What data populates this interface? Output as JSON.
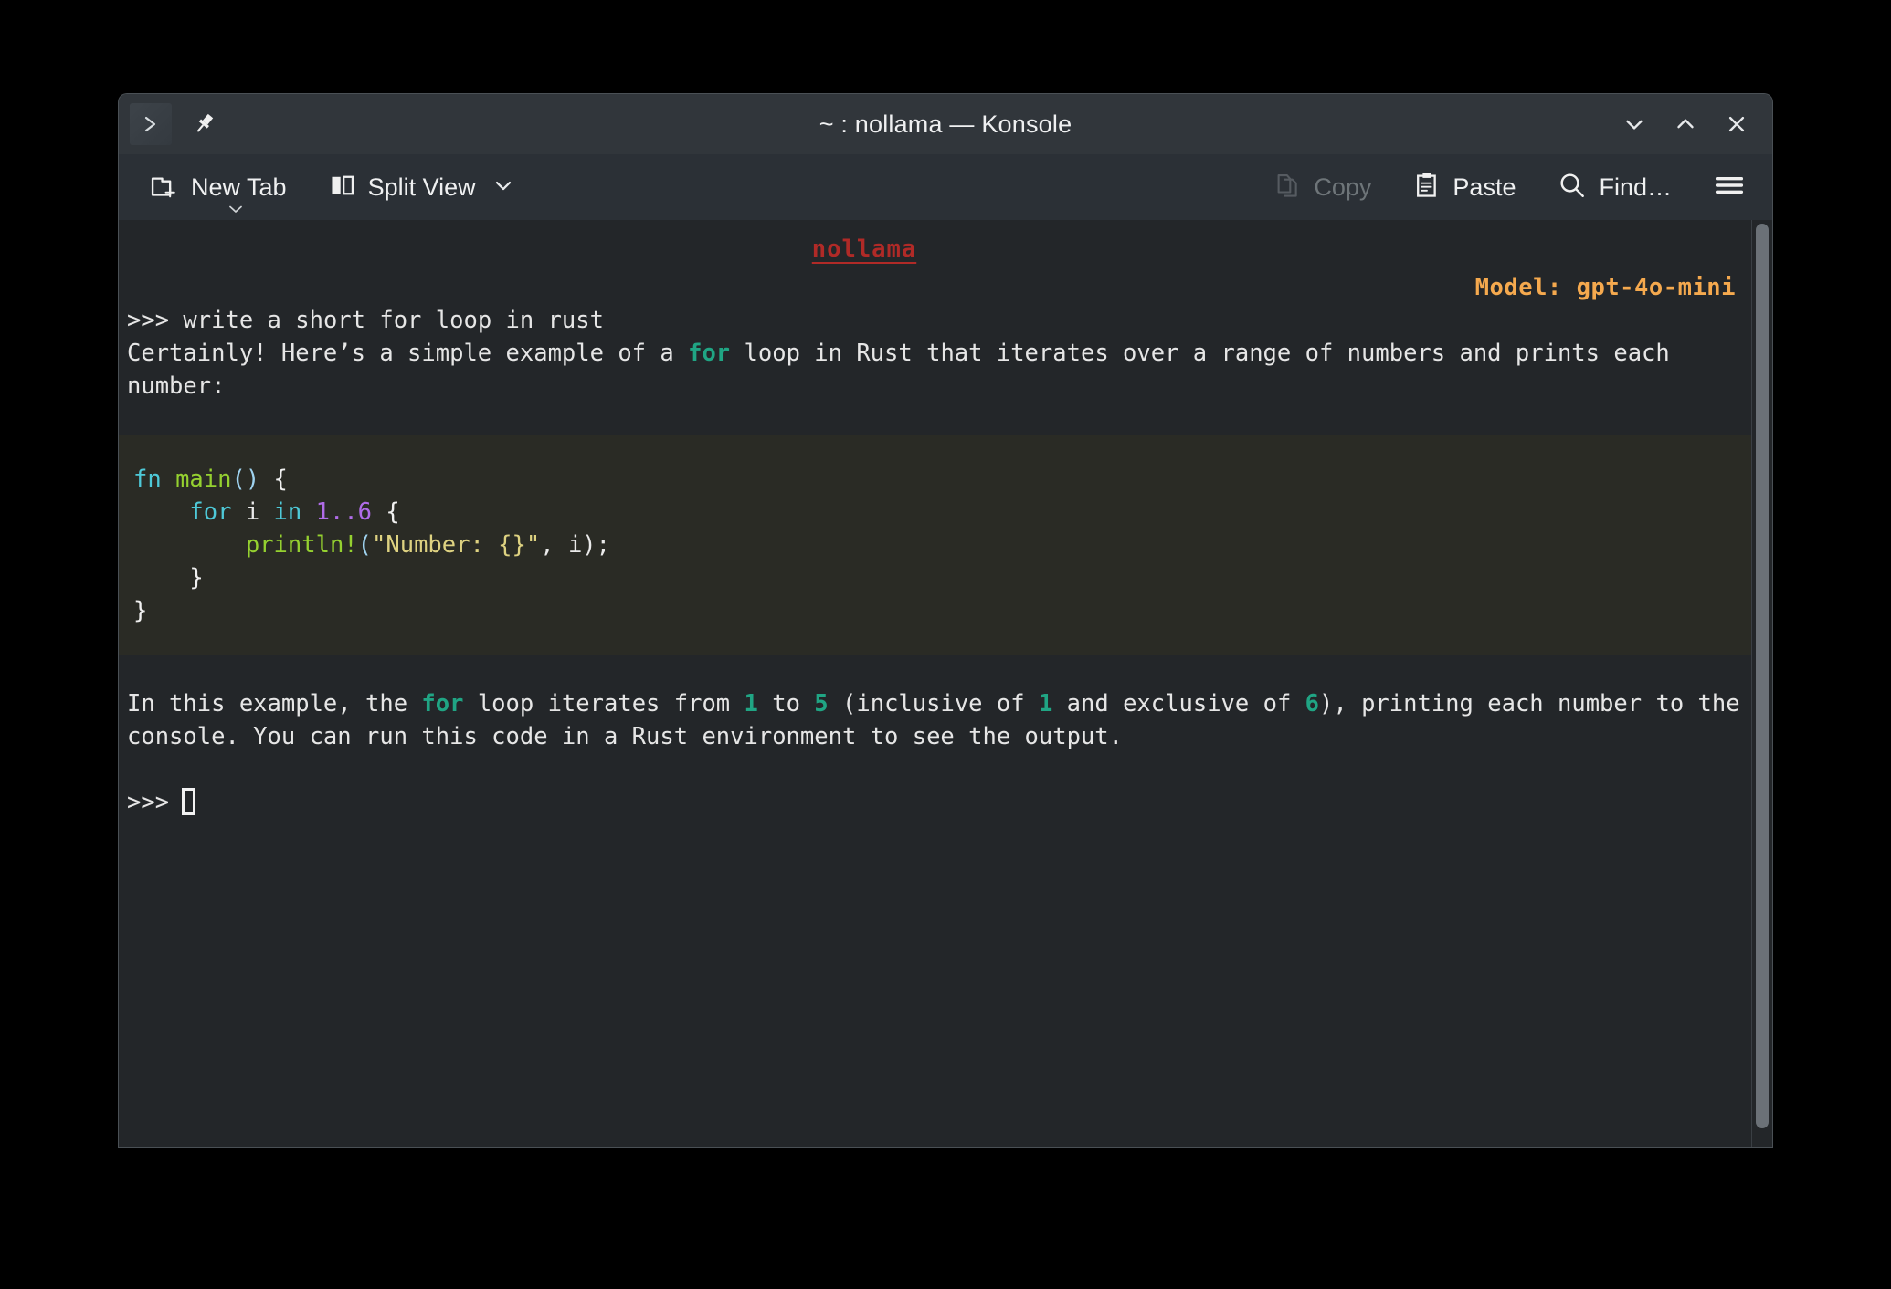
{
  "window": {
    "title": "~ : nollama — Konsole",
    "app_icon": "terminal-prompt-icon",
    "pin_icon": "pin-icon",
    "minimize_icon": "chevron-down-icon",
    "maximize_icon": "chevron-up-icon",
    "close_icon": "close-icon"
  },
  "toolbar": {
    "new_tab_label": "New Tab",
    "new_tab_icon": "new-tab-icon",
    "new_tab_more_icon": "chevron-down-small-icon",
    "split_view_label": "Split View",
    "split_view_icon": "split-view-icon",
    "split_view_chevron_icon": "chevron-down-icon",
    "copy_label": "Copy",
    "copy_icon": "copy-icon",
    "copy_disabled": true,
    "paste_label": "Paste",
    "paste_icon": "clipboard-paste-icon",
    "find_label": "Find…",
    "find_icon": "search-icon",
    "menu_icon": "hamburger-menu-icon"
  },
  "terminal": {
    "banner": "nollama",
    "model_line": "Model: gpt-4o-mini",
    "prompt_symbol": ">>>",
    "user_command": "write a short for loop in rust",
    "intro": {
      "part1": "Certainly! Here’s a simple example of a ",
      "code1": "for",
      "part2": " loop in Rust that iterates over a range of numbers and prints each number:"
    },
    "code": {
      "line1_kw": "fn",
      "line1_name": " main",
      "line1_paren": "()",
      "line1_brace": " {",
      "line2_indent": "    ",
      "line2_kw1": "for",
      "line2_var": " i ",
      "line2_kw2": "in",
      "line2_num": " 1..6",
      "line2_brace": " {",
      "line3_indent": "        ",
      "line3_macro": "println!",
      "line3_paren_open": "(",
      "line3_string": "\"Number: {}\"",
      "line3_args": ", i)",
      "line3_semi": ";",
      "line4": "    }",
      "line5": "}"
    },
    "outro": {
      "part1": "In this example, the ",
      "code1": "for",
      "part2": " loop iterates from ",
      "code2": "1",
      "part3": " to ",
      "code3": "5",
      "part4": " (inclusive of ",
      "code4": "1",
      "part5": " and exclusive of ",
      "code5": "6",
      "part6": "), printing each number to the console. You can run this code in a Rust environment to see the output."
    }
  },
  "colors": {
    "window_chrome": "#31363b",
    "toolbar_bg": "#2b3036",
    "terminal_bg": "#232629",
    "code_block_bg": "#2a2b25",
    "banner_red": "#b02a27",
    "model_orange": "#f5a94e",
    "inline_code_teal": "#20a584",
    "keyword_cyan": "#4ec9d8",
    "function_green": "#95d130",
    "number_purple": "#b06ce8",
    "string_yellow": "#ded281"
  }
}
